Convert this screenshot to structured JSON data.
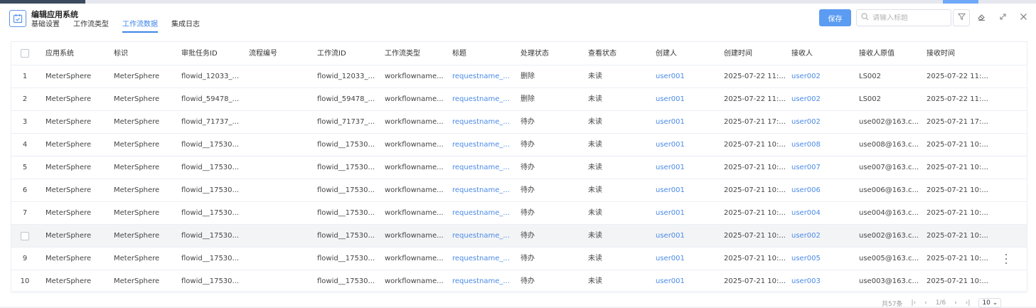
{
  "window": {
    "title": "编辑应用系统",
    "tabs": [
      {
        "label": "基础设置",
        "active": false
      },
      {
        "label": "工作流类型",
        "active": false
      },
      {
        "label": "工作流数据",
        "active": true
      },
      {
        "label": "集成日志",
        "active": false
      }
    ],
    "save_label": "保存",
    "search_placeholder": "请输入标题"
  },
  "colors": {
    "accent": "#3e85e8",
    "save_button": "#5b9cf2",
    "link": "#4a8ae6",
    "hover_row": "#f3f4f6"
  },
  "table": {
    "headers": [
      "应用系统",
      "标识",
      "审批任务ID",
      "流程编号",
      "工作流ID",
      "工作流类型",
      "标题",
      "处理状态",
      "查看状态",
      "创建人",
      "创建时间",
      "接收人",
      "接收人原值",
      "接收时间"
    ],
    "rows": [
      {
        "no": "1",
        "app": "MeterSphere",
        "code": "MeterSphere",
        "task_id": "flowid_12033_...",
        "flow_no": "",
        "flow_id": "flowid_12033_...",
        "flow_type": "workflowname...",
        "title": "requestname_...",
        "status": "删除",
        "view": "未读",
        "creator": "user001",
        "created": "2025-07-22 11:...",
        "receiver": "user002",
        "receiver_raw": "LS002",
        "received": "2025-07-22 11:..."
      },
      {
        "no": "2",
        "app": "MeterSphere",
        "code": "MeterSphere",
        "task_id": "flowid_59478_...",
        "flow_no": "",
        "flow_id": "flowid_59478_...",
        "flow_type": "workflowname...",
        "title": "requestname_...",
        "status": "删除",
        "view": "未读",
        "creator": "user001",
        "created": "2025-07-22 11:...",
        "receiver": "user002",
        "receiver_raw": "LS002",
        "received": "2025-07-22 11:..."
      },
      {
        "no": "3",
        "app": "MeterSphere",
        "code": "MeterSphere",
        "task_id": "flowid_71737_...",
        "flow_no": "",
        "flow_id": "flowid_71737_...",
        "flow_type": "workflowname...",
        "title": "requestname_...",
        "status": "待办",
        "view": "未读",
        "creator": "user001",
        "created": "2025-07-21 17:...",
        "receiver": "user002",
        "receiver_raw": "use002@163.c...",
        "received": "2025-07-21 17:..."
      },
      {
        "no": "4",
        "app": "MeterSphere",
        "code": "MeterSphere",
        "task_id": "flowid__17530...",
        "flow_no": "",
        "flow_id": "flowid__17530...",
        "flow_type": "workflowname...",
        "title": "requestname_...",
        "status": "待办",
        "view": "未读",
        "creator": "user001",
        "created": "2025-07-21 10:...",
        "receiver": "user008",
        "receiver_raw": "use008@163.c...",
        "received": "2025-07-21 10:..."
      },
      {
        "no": "5",
        "app": "MeterSphere",
        "code": "MeterSphere",
        "task_id": "flowid__17530...",
        "flow_no": "",
        "flow_id": "flowid__17530...",
        "flow_type": "workflowname...",
        "title": "requestname_...",
        "status": "待办",
        "view": "未读",
        "creator": "user001",
        "created": "2025-07-21 10:...",
        "receiver": "user007",
        "receiver_raw": "use007@163.c...",
        "received": "2025-07-21 10:..."
      },
      {
        "no": "6",
        "app": "MeterSphere",
        "code": "MeterSphere",
        "task_id": "flowid__17530...",
        "flow_no": "",
        "flow_id": "flowid__17530...",
        "flow_type": "workflowname...",
        "title": "requestname_...",
        "status": "待办",
        "view": "未读",
        "creator": "user001",
        "created": "2025-07-21 10:...",
        "receiver": "user006",
        "receiver_raw": "use006@163.c...",
        "received": "2025-07-21 10:..."
      },
      {
        "no": "7",
        "app": "MeterSphere",
        "code": "MeterSphere",
        "task_id": "flowid__17530...",
        "flow_no": "",
        "flow_id": "flowid__17530...",
        "flow_type": "workflowname...",
        "title": "requestname_...",
        "status": "待办",
        "view": "未读",
        "creator": "user001",
        "created": "2025-07-21 10:...",
        "receiver": "user004",
        "receiver_raw": "use004@163.c...",
        "received": "2025-07-21 10:..."
      },
      {
        "no": "",
        "app": "MeterSphere",
        "code": "MeterSphere",
        "task_id": "flowid__17530...",
        "flow_no": "",
        "flow_id": "flowid__17530...",
        "flow_type": "workflowname...",
        "title": "requestname_...",
        "status": "待办",
        "view": "未读",
        "creator": "user001",
        "created": "2025-07-21 10:...",
        "receiver": "user002",
        "receiver_raw": "use002@163.c...",
        "received": "2025-07-21 10:...",
        "hover": true
      },
      {
        "no": "9",
        "app": "MeterSphere",
        "code": "MeterSphere",
        "task_id": "flowid__17530...",
        "flow_no": "",
        "flow_id": "flowid__17530...",
        "flow_type": "workflowname...",
        "title": "requestname_...",
        "status": "待办",
        "view": "未读",
        "creator": "user001",
        "created": "2025-07-21 10:...",
        "receiver": "user005",
        "receiver_raw": "use005@163.c...",
        "received": "2025-07-21 10:...",
        "more": true
      },
      {
        "no": "10",
        "app": "MeterSphere",
        "code": "MeterSphere",
        "task_id": "flowid__17530...",
        "flow_no": "",
        "flow_id": "flowid__17530...",
        "flow_type": "workflowname...",
        "title": "requestname_...",
        "status": "待办",
        "view": "未读",
        "creator": "user001",
        "created": "2025-07-21 10:...",
        "receiver": "user003",
        "receiver_raw": "use003@163.c...",
        "received": "2025-07-21 10:..."
      }
    ]
  },
  "pager": {
    "total": "共57条",
    "page": "1/6",
    "page_size": "10"
  }
}
